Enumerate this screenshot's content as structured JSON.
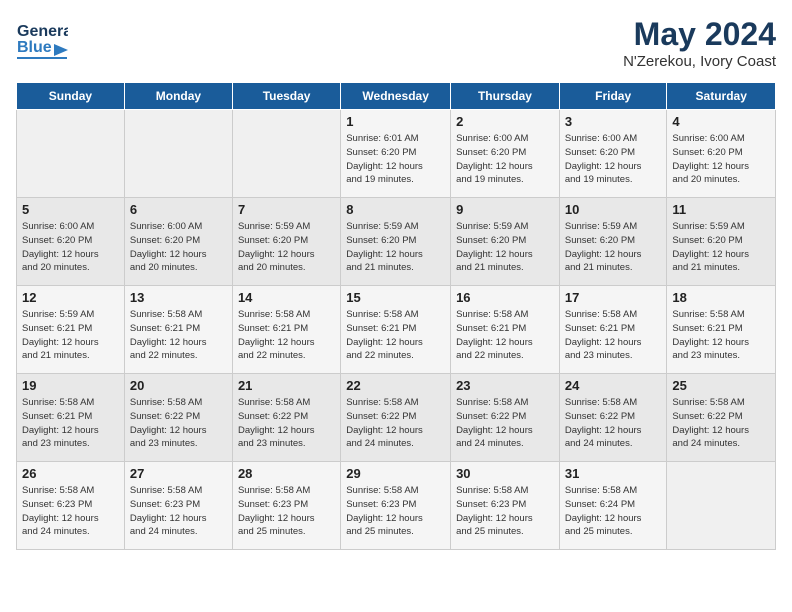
{
  "header": {
    "logo_line1": "General",
    "logo_line2": "Blue",
    "month_year": "May 2024",
    "location": "N'Zerekou, Ivory Coast"
  },
  "weekdays": [
    "Sunday",
    "Monday",
    "Tuesday",
    "Wednesday",
    "Thursday",
    "Friday",
    "Saturday"
  ],
  "weeks": [
    [
      {
        "date": "",
        "info": ""
      },
      {
        "date": "",
        "info": ""
      },
      {
        "date": "",
        "info": ""
      },
      {
        "date": "1",
        "info": "Sunrise: 6:01 AM\nSunset: 6:20 PM\nDaylight: 12 hours\nand 19 minutes."
      },
      {
        "date": "2",
        "info": "Sunrise: 6:00 AM\nSunset: 6:20 PM\nDaylight: 12 hours\nand 19 minutes."
      },
      {
        "date": "3",
        "info": "Sunrise: 6:00 AM\nSunset: 6:20 PM\nDaylight: 12 hours\nand 19 minutes."
      },
      {
        "date": "4",
        "info": "Sunrise: 6:00 AM\nSunset: 6:20 PM\nDaylight: 12 hours\nand 20 minutes."
      }
    ],
    [
      {
        "date": "5",
        "info": "Sunrise: 6:00 AM\nSunset: 6:20 PM\nDaylight: 12 hours\nand 20 minutes."
      },
      {
        "date": "6",
        "info": "Sunrise: 6:00 AM\nSunset: 6:20 PM\nDaylight: 12 hours\nand 20 minutes."
      },
      {
        "date": "7",
        "info": "Sunrise: 5:59 AM\nSunset: 6:20 PM\nDaylight: 12 hours\nand 20 minutes."
      },
      {
        "date": "8",
        "info": "Sunrise: 5:59 AM\nSunset: 6:20 PM\nDaylight: 12 hours\nand 21 minutes."
      },
      {
        "date": "9",
        "info": "Sunrise: 5:59 AM\nSunset: 6:20 PM\nDaylight: 12 hours\nand 21 minutes."
      },
      {
        "date": "10",
        "info": "Sunrise: 5:59 AM\nSunset: 6:20 PM\nDaylight: 12 hours\nand 21 minutes."
      },
      {
        "date": "11",
        "info": "Sunrise: 5:59 AM\nSunset: 6:20 PM\nDaylight: 12 hours\nand 21 minutes."
      }
    ],
    [
      {
        "date": "12",
        "info": "Sunrise: 5:59 AM\nSunset: 6:21 PM\nDaylight: 12 hours\nand 21 minutes."
      },
      {
        "date": "13",
        "info": "Sunrise: 5:58 AM\nSunset: 6:21 PM\nDaylight: 12 hours\nand 22 minutes."
      },
      {
        "date": "14",
        "info": "Sunrise: 5:58 AM\nSunset: 6:21 PM\nDaylight: 12 hours\nand 22 minutes."
      },
      {
        "date": "15",
        "info": "Sunrise: 5:58 AM\nSunset: 6:21 PM\nDaylight: 12 hours\nand 22 minutes."
      },
      {
        "date": "16",
        "info": "Sunrise: 5:58 AM\nSunset: 6:21 PM\nDaylight: 12 hours\nand 22 minutes."
      },
      {
        "date": "17",
        "info": "Sunrise: 5:58 AM\nSunset: 6:21 PM\nDaylight: 12 hours\nand 23 minutes."
      },
      {
        "date": "18",
        "info": "Sunrise: 5:58 AM\nSunset: 6:21 PM\nDaylight: 12 hours\nand 23 minutes."
      }
    ],
    [
      {
        "date": "19",
        "info": "Sunrise: 5:58 AM\nSunset: 6:21 PM\nDaylight: 12 hours\nand 23 minutes."
      },
      {
        "date": "20",
        "info": "Sunrise: 5:58 AM\nSunset: 6:22 PM\nDaylight: 12 hours\nand 23 minutes."
      },
      {
        "date": "21",
        "info": "Sunrise: 5:58 AM\nSunset: 6:22 PM\nDaylight: 12 hours\nand 23 minutes."
      },
      {
        "date": "22",
        "info": "Sunrise: 5:58 AM\nSunset: 6:22 PM\nDaylight: 12 hours\nand 24 minutes."
      },
      {
        "date": "23",
        "info": "Sunrise: 5:58 AM\nSunset: 6:22 PM\nDaylight: 12 hours\nand 24 minutes."
      },
      {
        "date": "24",
        "info": "Sunrise: 5:58 AM\nSunset: 6:22 PM\nDaylight: 12 hours\nand 24 minutes."
      },
      {
        "date": "25",
        "info": "Sunrise: 5:58 AM\nSunset: 6:22 PM\nDaylight: 12 hours\nand 24 minutes."
      }
    ],
    [
      {
        "date": "26",
        "info": "Sunrise: 5:58 AM\nSunset: 6:23 PM\nDaylight: 12 hours\nand 24 minutes."
      },
      {
        "date": "27",
        "info": "Sunrise: 5:58 AM\nSunset: 6:23 PM\nDaylight: 12 hours\nand 24 minutes."
      },
      {
        "date": "28",
        "info": "Sunrise: 5:58 AM\nSunset: 6:23 PM\nDaylight: 12 hours\nand 25 minutes."
      },
      {
        "date": "29",
        "info": "Sunrise: 5:58 AM\nSunset: 6:23 PM\nDaylight: 12 hours\nand 25 minutes."
      },
      {
        "date": "30",
        "info": "Sunrise: 5:58 AM\nSunset: 6:23 PM\nDaylight: 12 hours\nand 25 minutes."
      },
      {
        "date": "31",
        "info": "Sunrise: 5:58 AM\nSunset: 6:24 PM\nDaylight: 12 hours\nand 25 minutes."
      },
      {
        "date": "",
        "info": ""
      }
    ]
  ]
}
